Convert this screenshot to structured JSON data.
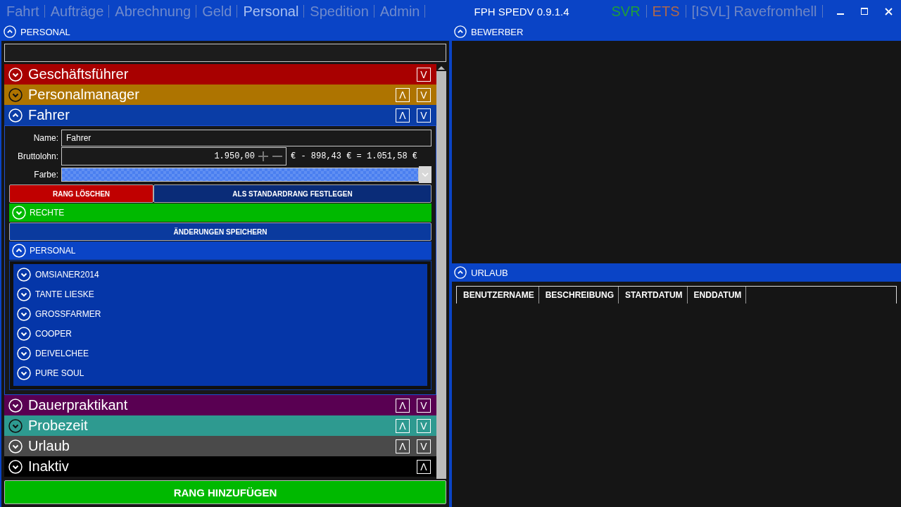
{
  "nav": {
    "tabs": [
      {
        "label": "Fahrt",
        "selected": false
      },
      {
        "label": "Aufträge",
        "selected": false
      },
      {
        "label": "Abrechnung",
        "selected": false
      },
      {
        "label": "Geld",
        "selected": false
      },
      {
        "label": "Personal",
        "selected": true
      },
      {
        "label": "Spedition",
        "selected": false
      },
      {
        "label": "Admin",
        "selected": false
      }
    ]
  },
  "window": {
    "title": "FPH SPEDV 0.9.1.4",
    "status": [
      {
        "label": "SVR",
        "color": "#1f9e3a"
      },
      {
        "label": "ETS",
        "color": "#b0684a"
      },
      {
        "label": "[ISVL] Ravefromhell",
        "color": "#6f86c4"
      }
    ]
  },
  "personal_panel": {
    "title": "PERSONAL",
    "expanded": true,
    "ranks": [
      {
        "name": "Geschäftsführer",
        "color": "#a80000",
        "expanded": false,
        "controls": [
          "V"
        ]
      },
      {
        "name": "Personalmanager",
        "color": "#ae7400",
        "expanded": false,
        "controls": [
          "Λ",
          "V"
        ]
      },
      {
        "name": "Fahrer",
        "color": "#0a3da6",
        "expanded": true,
        "controls": [
          "Λ",
          "V"
        ],
        "details": {
          "name_label": "Name:",
          "name_value": "Fahrer",
          "salary_label": "Bruttolohn:",
          "salary_value": "1.950,00",
          "salary_result": "€ - 898,43 € = 1.051,58 €",
          "color_label": "Farbe:",
          "color": "#4a7ff0",
          "delete_button": "RANG LÖSCHEN",
          "default_button": "ALS STANDARDRANG FESTLEGEN",
          "rights": {
            "title": "RECHTE",
            "expanded": false
          },
          "save_button": "ÄNDERUNGEN SPEICHERN",
          "group": {
            "title": "PERSONAL",
            "expanded": true,
            "members": [
              {
                "name": "OMSIANER2014",
                "expanded": false
              },
              {
                "name": "TANTE LIESKE",
                "expanded": false
              },
              {
                "name": "GROSSFARMER",
                "expanded": false
              },
              {
                "name": "COOPER",
                "expanded": false
              },
              {
                "name": "DEIVELCHEE",
                "expanded": false
              },
              {
                "name": "PURE SOUL",
                "expanded": false
              }
            ]
          }
        }
      },
      {
        "name": "Dauerpraktikant",
        "color": "#590052",
        "expanded": false,
        "controls": [
          "Λ",
          "V"
        ]
      },
      {
        "name": "Probezeit",
        "color": "#2e9a90",
        "expanded": false,
        "controls": [
          "Λ",
          "V"
        ]
      },
      {
        "name": "Urlaub",
        "color": "#4a4a4a",
        "expanded": false,
        "controls": [
          "Λ",
          "V"
        ]
      },
      {
        "name": "Inaktiv",
        "color": "#000000",
        "expanded": false,
        "controls": [
          "Λ"
        ]
      }
    ],
    "add_button": "RANG HINZUFÜGEN"
  },
  "applicants_panel": {
    "title": "BEWERBER",
    "expanded": true
  },
  "vacation_panel": {
    "title": "URLAUB",
    "expanded": true,
    "table": {
      "columns": [
        "BENUTZERNAME",
        "BESCHREIBUNG",
        "STARTDATUM",
        "ENDDATUM"
      ]
    }
  }
}
